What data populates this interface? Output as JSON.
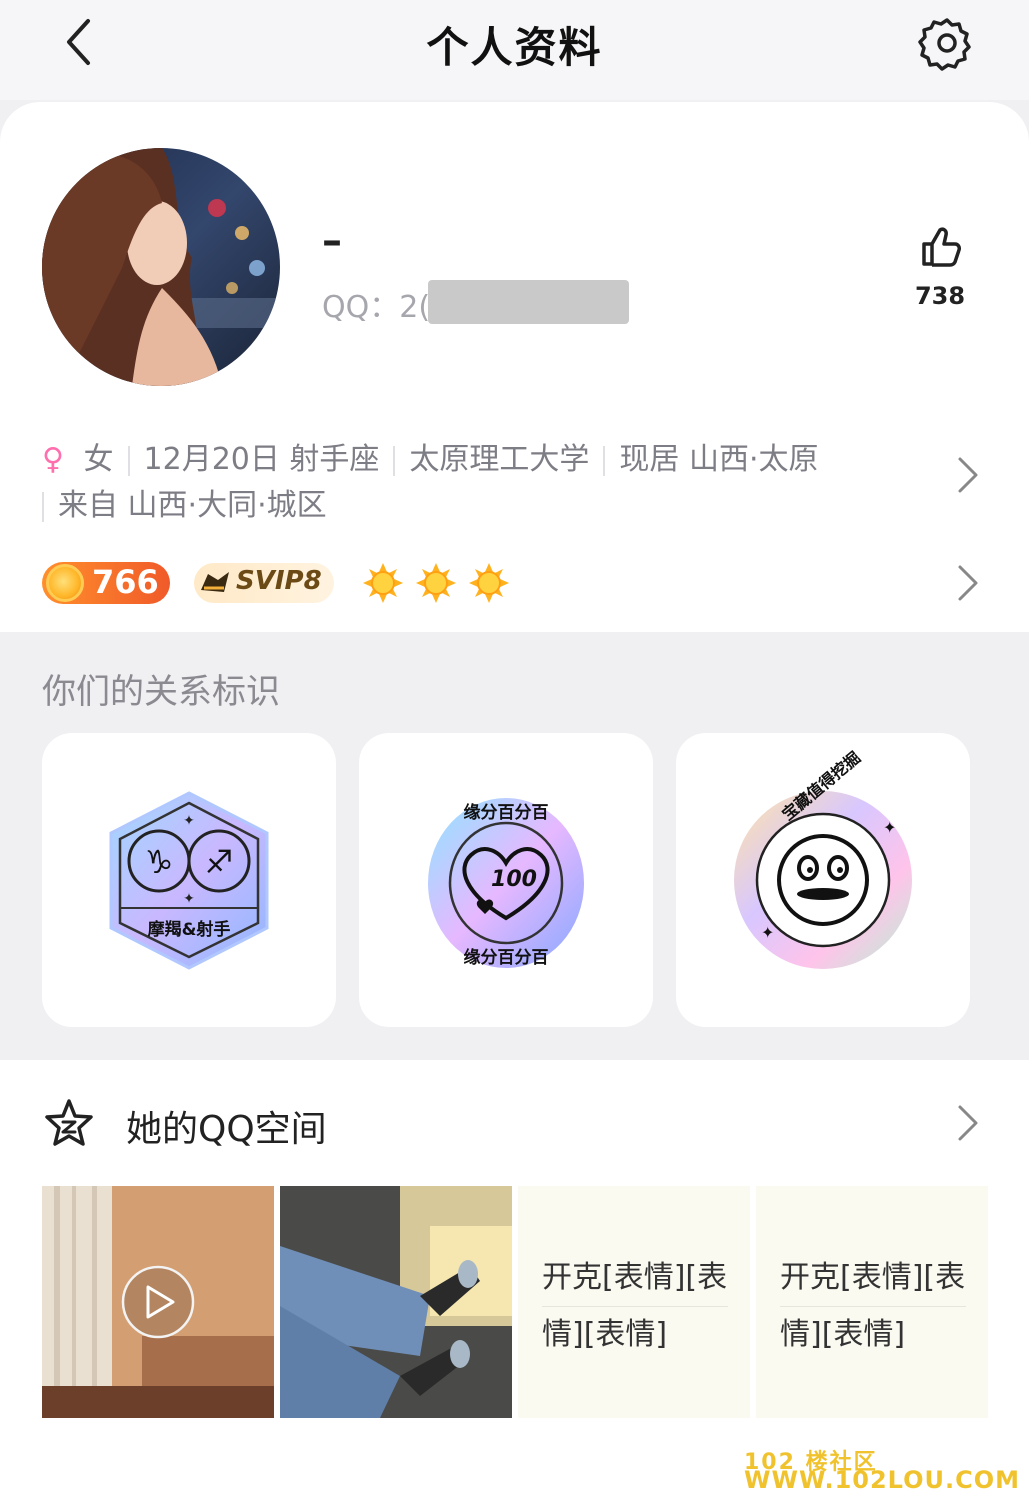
{
  "header": {
    "title": "个人资料"
  },
  "profile": {
    "nickname": "–",
    "qq_label": "QQ：2(",
    "likes": "738"
  },
  "info": {
    "gender_symbol": "♀",
    "gender": "女",
    "birthday": "12月20日 射手座",
    "school": "太原理工大学",
    "residence": "现居 山西·太原",
    "hometown": "来自 山西·大同·城区"
  },
  "badges": {
    "level": "766",
    "svip": "SVIP8"
  },
  "relation": {
    "title": "你们的关系标识",
    "cards": [
      {
        "label": "摩羯&射手"
      },
      {
        "ring_text": "缘分百分百",
        "number": "100"
      },
      {
        "ring_text": "宝藏值得挖掘"
      }
    ]
  },
  "qzone": {
    "title": "她的QQ空间",
    "posts": [
      {
        "line1": "开克[表情][表",
        "line2": "情][表情]"
      },
      {
        "line1": "开克[表情][表",
        "line2": "情][表情]"
      }
    ]
  },
  "watermark": {
    "line1": "102 楼社区",
    "line2": "WWW.102LOU.COM"
  },
  "colors": {
    "accent_pink": "#ff6fae",
    "level_orange": "#f05a2a",
    "svip_brown": "#6b4a16"
  }
}
